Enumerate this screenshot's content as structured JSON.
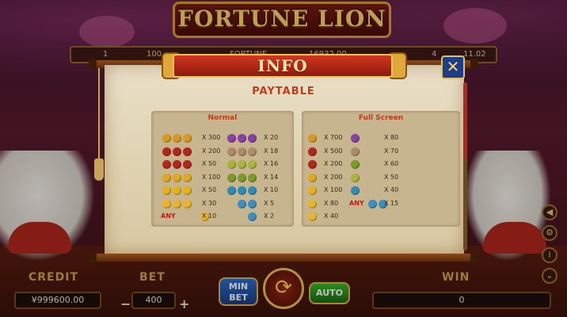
{
  "game": {
    "logo_text": "FORTUNE LION",
    "topbar": {
      "left1": "1",
      "left2": "100",
      "mid": "FORTUNE",
      "mid_value": "16932.00",
      "right1": "4",
      "right2": "11.02"
    }
  },
  "panel": {
    "header": "INFO",
    "subtitle": "PAYTABLE",
    "close_label": "✕"
  },
  "paytable": {
    "normal": {
      "title": "Normal",
      "left_rows": [
        {
          "symbols": 3,
          "color": "#d79a1e",
          "any": "",
          "mult": "X 300"
        },
        {
          "symbols": 3,
          "color": "#b3261e",
          "any": "",
          "mult": "X 200"
        },
        {
          "symbols": 3,
          "color": "#b3261e",
          "any": "",
          "mult": "X 50"
        },
        {
          "symbols": 3,
          "color": "#e0a820",
          "any": "",
          "mult": "X 100"
        },
        {
          "symbols": 3,
          "color": "#e6b21a",
          "any": "",
          "mult": "X 50"
        },
        {
          "symbols": 3,
          "color": "#e9b52c",
          "any": "",
          "mult": "X 30"
        },
        {
          "symbols": 1,
          "color": "#e9b52c",
          "any": "ANY",
          "mult": "X 10"
        }
      ],
      "right_rows": [
        {
          "symbols": 3,
          "color": "#8b3fa8",
          "any": "",
          "mult": "X 20"
        },
        {
          "symbols": 3,
          "color": "#b08b6a",
          "any": "",
          "mult": "X 18"
        },
        {
          "symbols": 3,
          "color": "#a9b53a",
          "any": "",
          "mult": "X 16"
        },
        {
          "symbols": 3,
          "color": "#7a9a2a",
          "any": "",
          "mult": "X 14"
        },
        {
          "symbols": 3,
          "color": "#2c8fb8",
          "any": "",
          "mult": "X 10"
        },
        {
          "symbols": 2,
          "color": "#3d8fc0",
          "any": "",
          "mult": "X 5"
        },
        {
          "symbols": 1,
          "color": "#3d8fc0",
          "any": "",
          "mult": "X 2"
        }
      ]
    },
    "fullscreen": {
      "title": "Full Screen",
      "left_rows": [
        {
          "color": "#d79a1e",
          "mult": "X 700"
        },
        {
          "color": "#b3261e",
          "mult": "X 500"
        },
        {
          "color": "#b3261e",
          "mult": "X 200"
        },
        {
          "color": "#e0a820",
          "mult": "X 200"
        },
        {
          "color": "#e6b21a",
          "mult": "X 100"
        },
        {
          "color": "#e9b52c",
          "mult": "X 80"
        },
        {
          "color": "#e9b52c",
          "mult": "X 40"
        }
      ],
      "right_rows": [
        {
          "color": "#8b3fa8",
          "any": "",
          "mult": "X 80"
        },
        {
          "color": "#b08b6a",
          "any": "",
          "mult": "X 70"
        },
        {
          "color": "#7a9a2a",
          "any": "",
          "mult": "X 60"
        },
        {
          "color": "#a9b53a",
          "any": "",
          "mult": "X 50"
        },
        {
          "color": "#2c8fb8",
          "any": "",
          "mult": "X 40"
        },
        {
          "color": "#3d8fc0",
          "any": "ANY",
          "mult": "X 15"
        }
      ]
    }
  },
  "controls": {
    "credit_label": "CREDIT",
    "credit_value": "¥999600.00",
    "bet_label": "BET",
    "bet_value": "400",
    "minus": "−",
    "plus": "+",
    "min_bet_line1": "MIN",
    "min_bet_line2": "BET",
    "spin_glyph": "⟳",
    "auto_label": "AUTO",
    "win_label": "WIN",
    "win_value": "0"
  },
  "side": {
    "sound": "◀",
    "settings": "⚙",
    "info": "i",
    "more": "⌄"
  }
}
